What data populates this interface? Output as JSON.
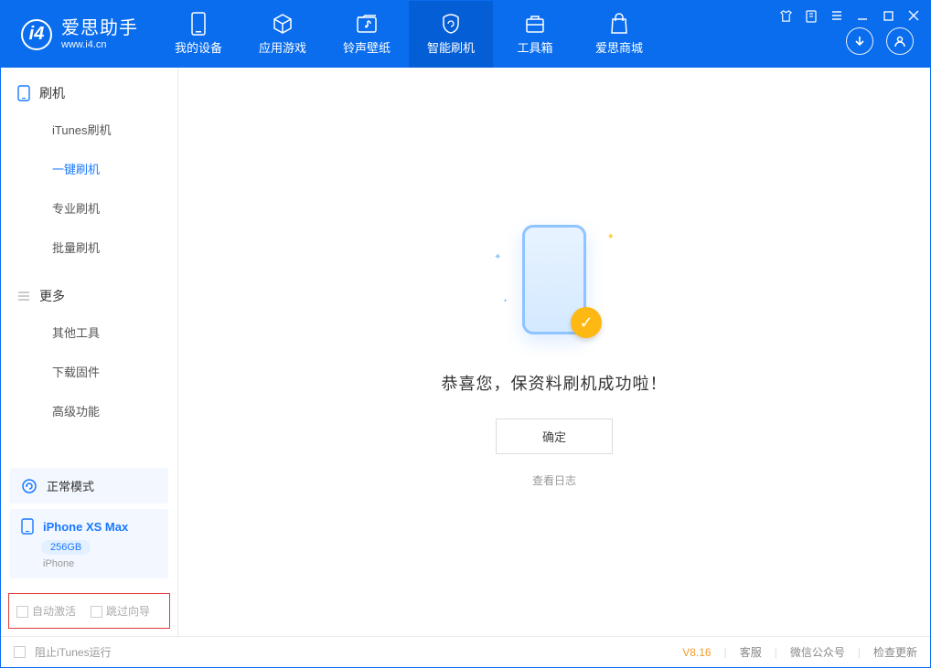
{
  "app": {
    "title": "爱思助手",
    "url": "www.i4.cn"
  },
  "nav": {
    "items": [
      {
        "label": "我的设备"
      },
      {
        "label": "应用游戏"
      },
      {
        "label": "铃声壁纸"
      },
      {
        "label": "智能刷机"
      },
      {
        "label": "工具箱"
      },
      {
        "label": "爱思商城"
      }
    ]
  },
  "sidebar": {
    "section1_title": "刷机",
    "section1_items": [
      "iTunes刷机",
      "一键刷机",
      "专业刷机",
      "批量刷机"
    ],
    "section2_title": "更多",
    "section2_items": [
      "其他工具",
      "下载固件",
      "高级功能"
    ],
    "mode_label": "正常模式",
    "device_name": "iPhone XS Max",
    "device_storage": "256GB",
    "device_type": "iPhone",
    "chk_auto_activate": "自动激活",
    "chk_skip_guide": "跳过向导"
  },
  "main": {
    "success_text": "恭喜您，保资料刷机成功啦！",
    "ok_label": "确定",
    "log_link": "查看日志"
  },
  "status": {
    "block_itunes": "阻止iTunes运行",
    "version": "V8.16",
    "support": "客服",
    "wechat": "微信公众号",
    "check_update": "检查更新"
  }
}
